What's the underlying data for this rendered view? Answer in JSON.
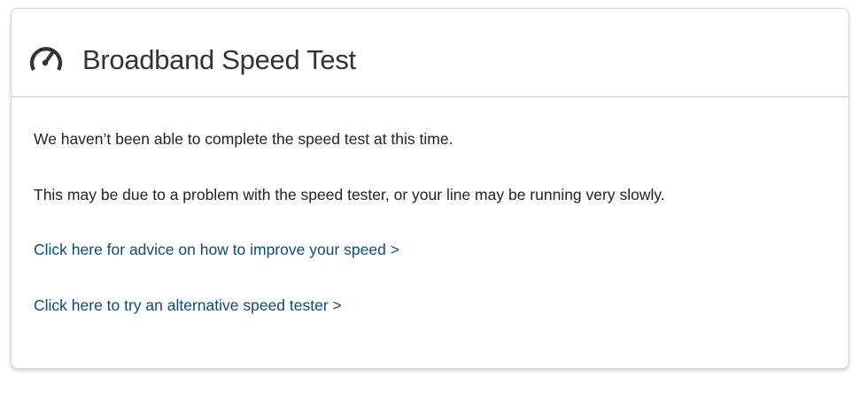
{
  "card": {
    "icon": "speedometer-icon",
    "title": "Broadband Speed Test",
    "messages": [
      "We haven’t been able to complete the speed test at this time.",
      "This may be due to a problem with the speed tester, or your line may be running very slowly."
    ],
    "links": [
      "Click here for advice on how to improve your speed >",
      "Click here to try an alternative speed tester >"
    ]
  },
  "colors": {
    "title_text": "#333333",
    "body_text": "#222222",
    "link": "#0e4a74",
    "border": "#d6d6d6",
    "icon": "#333333"
  }
}
